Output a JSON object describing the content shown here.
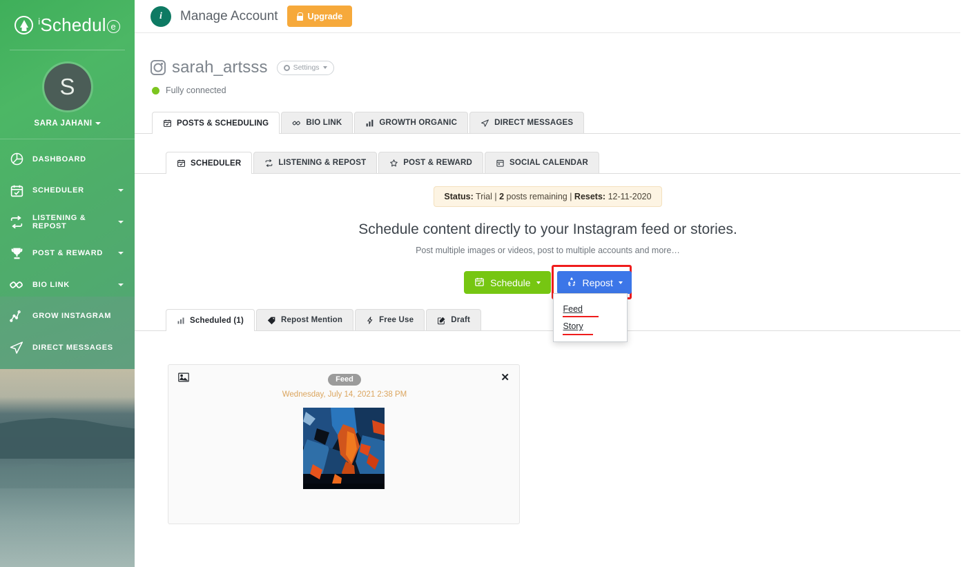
{
  "brand": {
    "name_main": "Schedul",
    "name_sup": "i",
    "name_suffix": "e",
    "logo_icon": "ai-schedule-logo-icon"
  },
  "sidebar": {
    "profile": {
      "avatar_initial": "S",
      "name": "SARA JAHANI"
    },
    "items": [
      {
        "label": "DASHBOARD",
        "icon": "pie-chart-icon",
        "has_caret": false
      },
      {
        "label": "SCHEDULER",
        "icon": "calendar-check-icon",
        "has_caret": true
      },
      {
        "label": "LISTENING & REPOST",
        "icon": "repeat-icon",
        "has_caret": true
      },
      {
        "label": "POST & REWARD",
        "icon": "trophy-icon",
        "has_caret": true
      },
      {
        "label": "BIO LINK",
        "icon": "link-chain-icon",
        "has_caret": true
      },
      {
        "label": "GROW INSTAGRAM",
        "icon": "line-graph-icon",
        "has_caret": false
      },
      {
        "label": "DIRECT MESSAGES",
        "icon": "paper-plane-icon",
        "has_caret": false
      }
    ]
  },
  "topbar": {
    "info_icon": "info-icon",
    "info_letter": "i",
    "manage_account": "Manage Account",
    "upgrade_label": "Upgrade",
    "upgrade_icon": "lock-icon",
    "upgrade_color": "#f6a93b"
  },
  "account": {
    "platform_icon": "instagram-icon",
    "username": "sarah_artsss",
    "settings_label": "Settings",
    "settings_icon": "gear-icon",
    "connection_status": "Fully connected",
    "connection_color": "#7cc51f"
  },
  "main_tabs": [
    {
      "label": "POSTS & SCHEDULING",
      "icon": "calendar-icon",
      "active": true
    },
    {
      "label": "BIO LINK",
      "icon": "link-icon",
      "active": false
    },
    {
      "label": "GROWTH ORGANIC",
      "icon": "bar-chart-icon",
      "active": false
    },
    {
      "label": "DIRECT MESSAGES",
      "icon": "paper-plane-icon",
      "active": false
    }
  ],
  "sub_tabs": [
    {
      "label": "SCHEDULER",
      "icon": "calendar-check-icon",
      "active": true
    },
    {
      "label": "LISTENING & REPOST",
      "icon": "repeat-icon",
      "active": false
    },
    {
      "label": "POST & REWARD",
      "icon": "star-icon",
      "active": false
    },
    {
      "label": "SOCIAL CALENDAR",
      "icon": "calendar-grid-icon",
      "active": false
    }
  ],
  "status": {
    "label_status": "Status:",
    "value_status": " Trial | ",
    "posts_count": "2",
    "posts_text": " posts remaining | ",
    "label_resets": "Resets:",
    "value_resets": " 12-11-2020"
  },
  "hero": {
    "heading": "Schedule content directly to your Instagram feed or stories.",
    "subtext": "Post multiple images or videos, post to multiple accounts and more…"
  },
  "actions": {
    "schedule_label": "Schedule",
    "schedule_icon": "calendar-check-icon",
    "schedule_color": "#76c612",
    "repost_label": "Repost",
    "repost_icon": "recycle-icon",
    "repost_color": "#3c76e8",
    "highlight_color": "#ef1c1c",
    "dropdown": [
      {
        "label": "Feed"
      },
      {
        "label": "Story"
      }
    ]
  },
  "post_tabs": [
    {
      "label": "Scheduled (1)",
      "icon": "bar-chart-icon",
      "active": true
    },
    {
      "label": "Repost Mention",
      "icon": "tag-icon",
      "active": false
    },
    {
      "label": "Free Use",
      "icon": "bolt-icon",
      "active": false
    },
    {
      "label": "Draft",
      "icon": "edit-icon",
      "active": false
    }
  ],
  "post_card": {
    "media_icon": "image-icon",
    "badge": "Feed",
    "date": "Wednesday, July 14, 2021 2:38 PM",
    "close_icon": "close-icon",
    "close_glyph": "✕",
    "thumbnail_alt": "abstract-painting-thumbnail"
  }
}
